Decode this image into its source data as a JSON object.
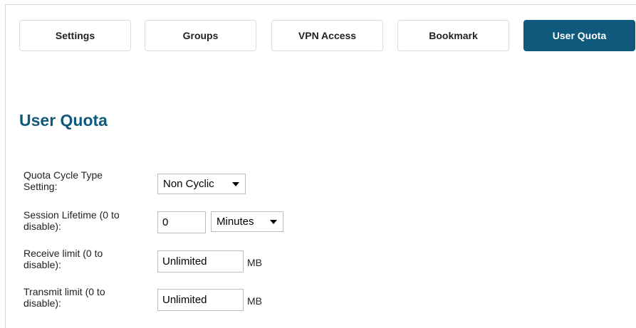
{
  "tabs": [
    {
      "label": "Settings"
    },
    {
      "label": "Groups"
    },
    {
      "label": "VPN Access"
    },
    {
      "label": "Bookmark"
    },
    {
      "label": "User Quota",
      "active": true
    }
  ],
  "section": {
    "title": "User Quota"
  },
  "form": {
    "quota_cycle": {
      "label_line1": "Quota Cycle Type",
      "label_line2": "Setting:",
      "selected": "Non Cyclic"
    },
    "session_lifetime": {
      "label_line1": "Session Lifetime (0 to",
      "label_line2": "disable):",
      "value": "0",
      "unit_selected": "Minutes"
    },
    "receive_limit": {
      "label_line1": "Receive limit (0 to",
      "label_line2": "disable):",
      "value": "Unlimited",
      "unit": "MB"
    },
    "transmit_limit": {
      "label_line1": "Transmit limit (0 to",
      "label_line2": "disable):",
      "value": "Unlimited",
      "unit": "MB"
    }
  },
  "colors": {
    "accent": "#0f5a7c",
    "border": "#dcdcdc"
  }
}
